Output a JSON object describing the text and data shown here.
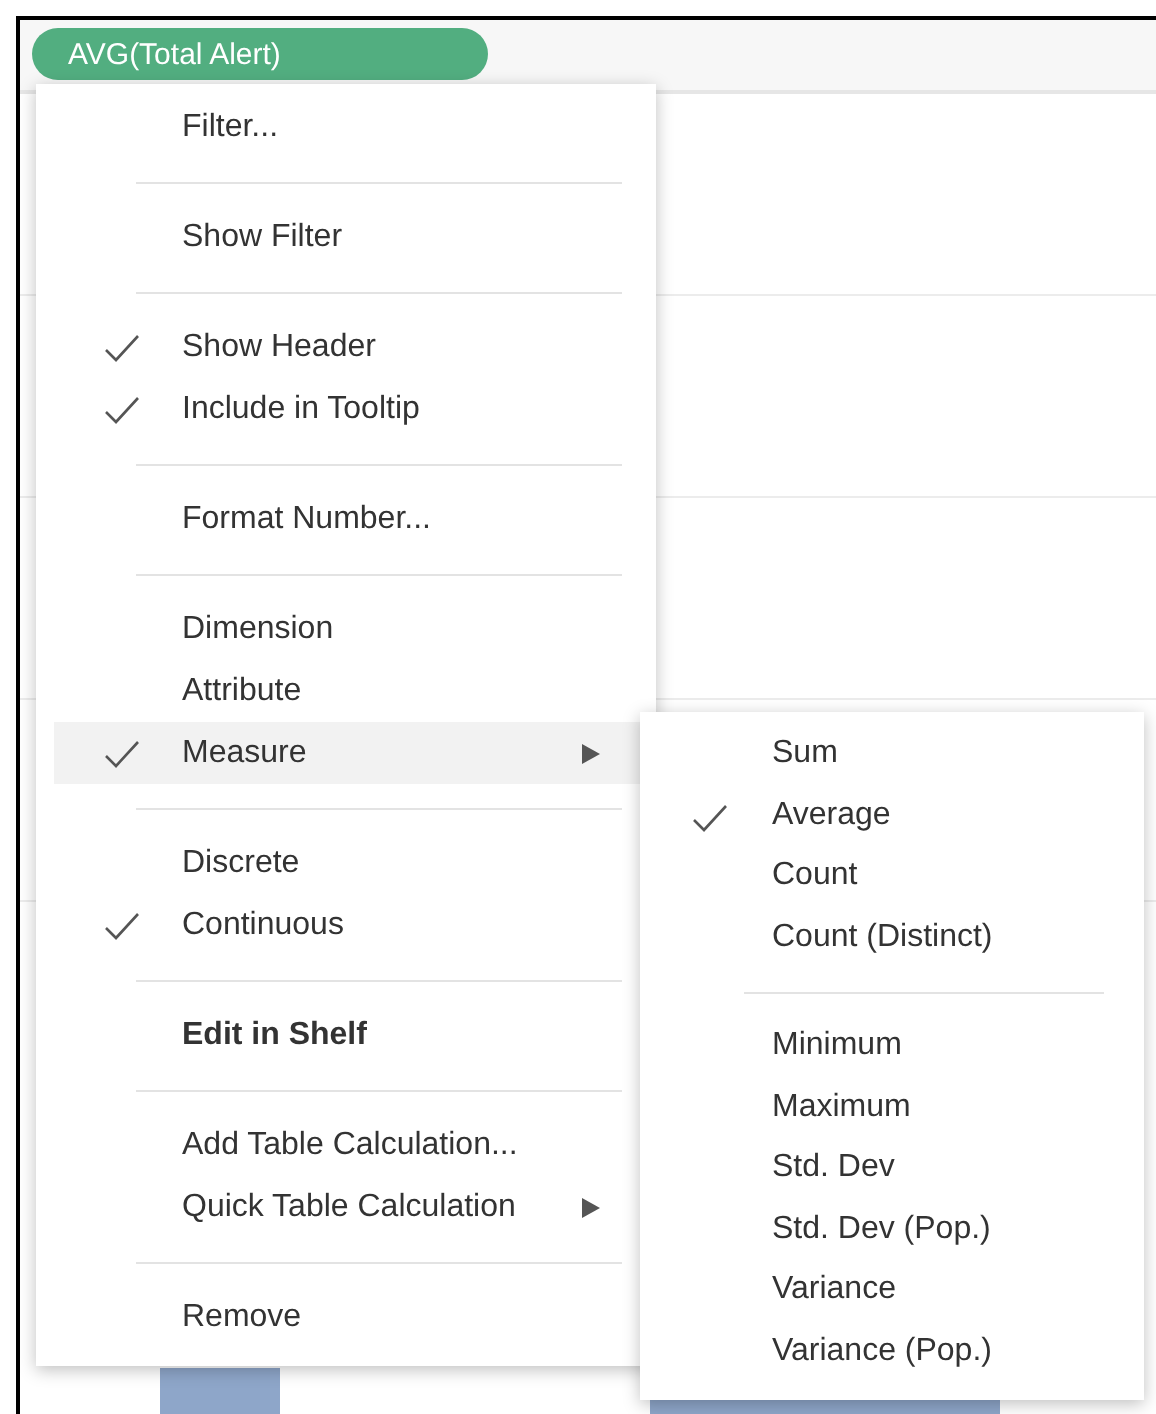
{
  "shelf_pill": {
    "label": "AVG(Total Alert)"
  },
  "context_menu": {
    "sections": [
      {
        "items": [
          {
            "label": "Filter...",
            "kind": "plain",
            "checked": false,
            "selected": false,
            "bold": false
          }
        ]
      },
      {
        "items": [
          {
            "label": "Show Filter",
            "kind": "plain",
            "checked": false,
            "selected": false,
            "bold": false
          }
        ]
      },
      {
        "items": [
          {
            "label": "Show Header",
            "kind": "plain",
            "checked": true,
            "selected": false,
            "bold": false
          },
          {
            "label": "Include in Tooltip",
            "kind": "plain",
            "checked": true,
            "selected": false,
            "bold": false
          }
        ]
      },
      {
        "items": [
          {
            "label": "Format Number...",
            "kind": "plain",
            "checked": false,
            "selected": false,
            "bold": false
          }
        ]
      },
      {
        "items": [
          {
            "label": "Dimension",
            "kind": "plain",
            "checked": false,
            "selected": false,
            "bold": false
          },
          {
            "label": "Attribute",
            "kind": "plain",
            "checked": false,
            "selected": false,
            "bold": false
          },
          {
            "label": "Measure",
            "kind": "submenu",
            "checked": true,
            "selected": true,
            "bold": false
          }
        ]
      },
      {
        "items": [
          {
            "label": "Discrete",
            "kind": "plain",
            "checked": false,
            "selected": false,
            "bold": false
          },
          {
            "label": "Continuous",
            "kind": "plain",
            "checked": true,
            "selected": false,
            "bold": false
          }
        ]
      },
      {
        "items": [
          {
            "label": "Edit in Shelf",
            "kind": "plain",
            "checked": false,
            "selected": false,
            "bold": true
          }
        ]
      },
      {
        "items": [
          {
            "label": "Add Table Calculation...",
            "kind": "plain",
            "checked": false,
            "selected": false,
            "bold": false
          },
          {
            "label": "Quick Table Calculation",
            "kind": "submenu",
            "checked": false,
            "selected": false,
            "bold": false
          }
        ]
      },
      {
        "items": [
          {
            "label": "Remove",
            "kind": "plain",
            "checked": false,
            "selected": false,
            "bold": false
          }
        ]
      }
    ]
  },
  "measure_submenu": {
    "sections": [
      {
        "items": [
          {
            "label": "Sum",
            "checked": false
          },
          {
            "label": "Average",
            "checked": true
          },
          {
            "label": "Count",
            "checked": false
          },
          {
            "label": "Count (Distinct)",
            "checked": false
          }
        ]
      },
      {
        "items": [
          {
            "label": "Minimum",
            "checked": false
          },
          {
            "label": "Maximum",
            "checked": false
          },
          {
            "label": "Std. Dev",
            "checked": false
          },
          {
            "label": "Std. Dev (Pop.)",
            "checked": false
          },
          {
            "label": "Variance",
            "checked": false
          },
          {
            "label": "Variance (Pop.)",
            "checked": false
          }
        ]
      }
    ]
  }
}
